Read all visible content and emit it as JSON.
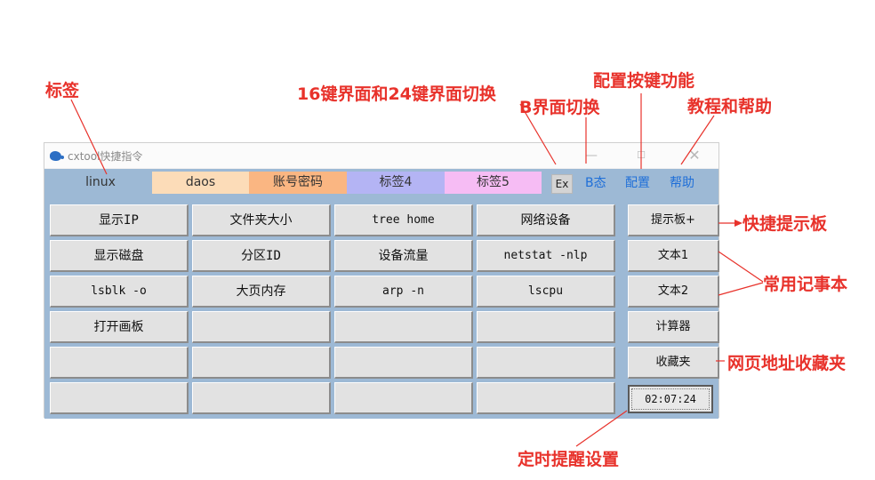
{
  "window": {
    "title": "cxtool快捷指令",
    "min_glyph": "—",
    "max_glyph": "☐",
    "close_glyph": "✕"
  },
  "tabs": [
    {
      "label": "linux",
      "color": "#9db9d5"
    },
    {
      "label": "daos",
      "color": "#fcdcb8"
    },
    {
      "label": "账号密码",
      "color": "#fab682"
    },
    {
      "label": "标签4",
      "color": "#b4b4f4"
    },
    {
      "label": "标签5",
      "color": "#f6bcf4"
    }
  ],
  "tab_actions": {
    "ex": "Ex",
    "b_state": "B态",
    "config": "配置",
    "help": "帮助"
  },
  "grid": [
    [
      "显示IP",
      "文件夹大小",
      "tree home",
      "网络设备"
    ],
    [
      "显示磁盘",
      "分区ID",
      "设备流量",
      "netstat -nlp"
    ],
    [
      "lsblk -o",
      "大页内存",
      "arp -n",
      "lscpu"
    ],
    [
      "打开画板",
      "",
      "",
      ""
    ],
    [
      "",
      "",
      "",
      ""
    ],
    [
      "",
      "",
      "",
      ""
    ]
  ],
  "side_buttons": [
    "提示板+",
    "文本1",
    "文本2",
    "计算器",
    "收藏夹"
  ],
  "clock": "02:07:24",
  "annotations": {
    "tabs": "标签",
    "switch_16_24": "16键界面和24键界面切换",
    "b_switch": "B界面切换",
    "config_keys": "配置按键功能",
    "tutorial": "教程和帮助",
    "hint_board": "快捷提示板",
    "notebook": "常用记事本",
    "favorites": "网页地址收藏夹",
    "timer": "定时提醒设置"
  },
  "colors": {
    "annotation": "#e8322b",
    "frame": "#9db9d5",
    "link": "#1f6fd8"
  }
}
